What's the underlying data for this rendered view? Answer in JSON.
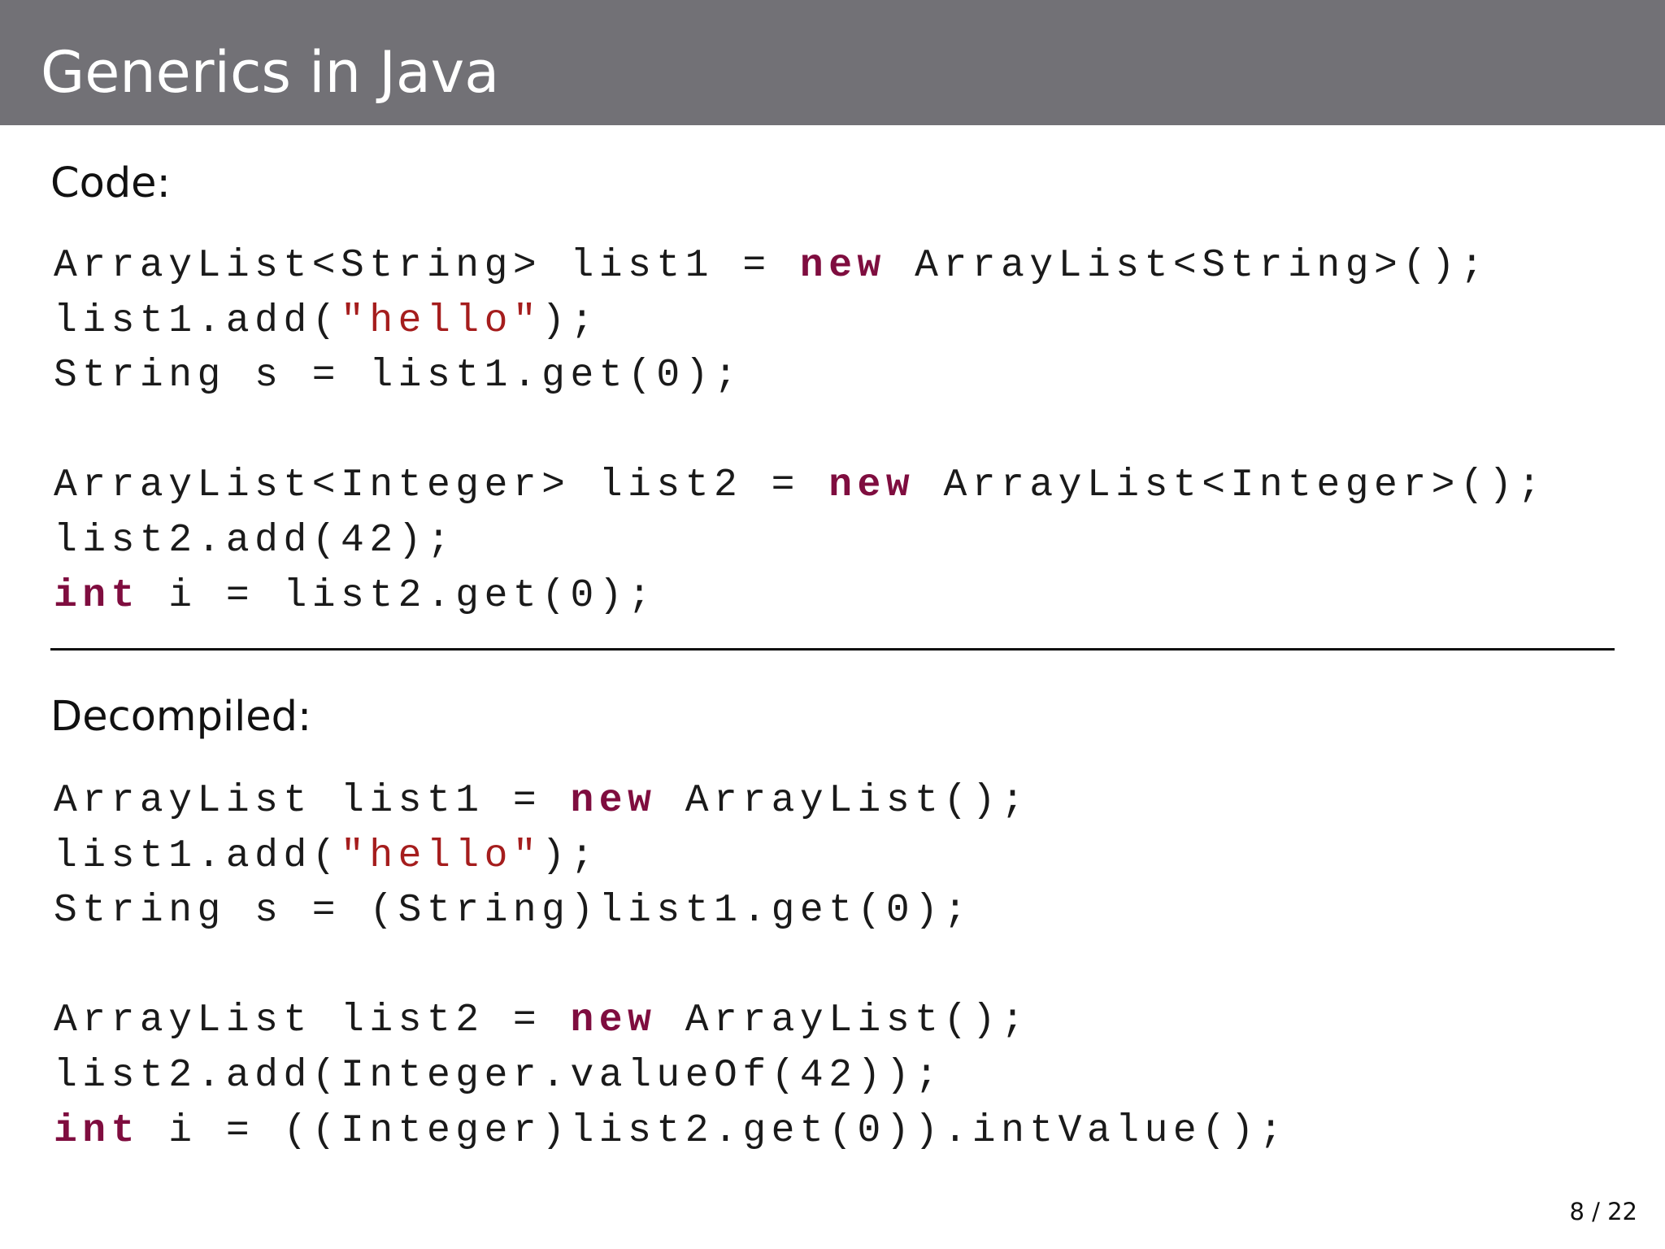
{
  "slide": {
    "title": "Generics in Java",
    "page_indicator": "8 / 22"
  },
  "colors": {
    "header_background": "#727176",
    "title_text": "#ffffff",
    "keyword": "#7f0d3f",
    "string_literal": "#a51d1d",
    "code_text": "#1a1a1a",
    "divider": "#111111"
  },
  "sections": [
    {
      "heading": "Code:",
      "lines": [
        [
          {
            "text": "ArrayList<String> list1 = ",
            "type": "plain"
          },
          {
            "text": "new",
            "type": "keyword"
          },
          {
            "text": " ArrayList<String>();",
            "type": "plain"
          }
        ],
        [
          {
            "text": "list1.add(",
            "type": "plain"
          },
          {
            "text": "\"hello\"",
            "type": "string"
          },
          {
            "text": ");",
            "type": "plain"
          }
        ],
        [
          {
            "text": "String s = list1.get(0);",
            "type": "plain"
          }
        ],
        [],
        [
          {
            "text": "ArrayList<Integer> list2 = ",
            "type": "plain"
          },
          {
            "text": "new",
            "type": "keyword"
          },
          {
            "text": " ArrayList<Integer>();",
            "type": "plain"
          }
        ],
        [
          {
            "text": "list2.add(42);",
            "type": "plain"
          }
        ],
        [
          {
            "text": "int",
            "type": "keyword"
          },
          {
            "text": " i = list2.get(0);",
            "type": "plain"
          }
        ]
      ]
    },
    {
      "heading": "Decompiled:",
      "lines": [
        [
          {
            "text": "ArrayList list1 = ",
            "type": "plain"
          },
          {
            "text": "new",
            "type": "keyword"
          },
          {
            "text": " ArrayList();",
            "type": "plain"
          }
        ],
        [
          {
            "text": "list1.add(",
            "type": "plain"
          },
          {
            "text": "\"hello\"",
            "type": "string"
          },
          {
            "text": ");",
            "type": "plain"
          }
        ],
        [
          {
            "text": "String s = (String)list1.get(0);",
            "type": "plain"
          }
        ],
        [],
        [
          {
            "text": "ArrayList list2 = ",
            "type": "plain"
          },
          {
            "text": "new",
            "type": "keyword"
          },
          {
            "text": " ArrayList();",
            "type": "plain"
          }
        ],
        [
          {
            "text": "list2.add(Integer.valueOf(42));",
            "type": "plain"
          }
        ],
        [
          {
            "text": "int",
            "type": "keyword"
          },
          {
            "text": " i = ((Integer)list2.get(0)).intValue();",
            "type": "plain"
          }
        ]
      ]
    }
  ]
}
